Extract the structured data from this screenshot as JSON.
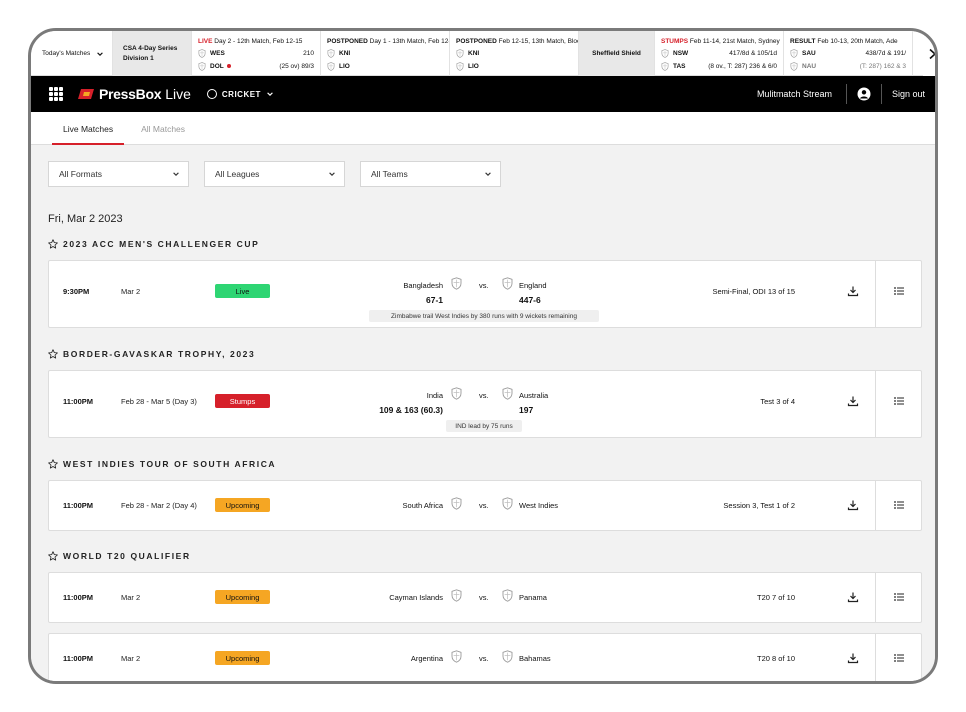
{
  "ticker": {
    "today_label": "Today's Matches",
    "series": {
      "line1": "CSA 4-Day Series",
      "line2": "Division 1"
    },
    "matches": [
      {
        "status": "LIVE",
        "status_color": "#d6202a",
        "detail": "Day 2 - 12th Match, Feb 12-15",
        "rows": [
          {
            "team": "WES",
            "score": "210",
            "dim": false,
            "live": false
          },
          {
            "team": "DOL",
            "score": "(25 ov) 89/3",
            "dim": false,
            "live": true
          }
        ]
      },
      {
        "status": "POSTPONED",
        "status_color": "#111111",
        "detail": "Day 1 - 13th Match, Feb 12-15",
        "rows": [
          {
            "team": "KNI",
            "score": "",
            "dim": false,
            "live": false
          },
          {
            "team": "LIO",
            "score": "",
            "dim": false,
            "live": false
          }
        ]
      },
      {
        "status": "POSTPONED",
        "status_color": "#111111",
        "detail": "Feb 12-15, 13th Match, Bloe.",
        "rows": [
          {
            "team": "KNI",
            "score": "",
            "dim": false,
            "live": false
          },
          {
            "team": "LIO",
            "score": "",
            "dim": false,
            "live": false
          }
        ]
      }
    ],
    "shield_label": "Sheffield Shield",
    "matches2": [
      {
        "status": "STUMPS",
        "status_color": "#d6202a",
        "detail": "Feb 11-14, 21st Match, Sydney",
        "rows": [
          {
            "team": "NSW",
            "score": "417/8d & 105/1d",
            "dim": false,
            "live": false
          },
          {
            "team": "TAS",
            "score": "(8 ov., T: 287) 236 & 6/0",
            "dim": false,
            "live": false
          }
        ]
      },
      {
        "status": "RESULT",
        "status_color": "#111111",
        "detail": "Feb 10-13, 20th Match, Ade",
        "rows": [
          {
            "team": "SAU",
            "score": "438/7d & 191/",
            "dim": false,
            "live": false
          },
          {
            "team": "NAU",
            "score": "(T: 287) 162 & 3",
            "dim": true,
            "live": false
          }
        ]
      }
    ]
  },
  "nav": {
    "brand_bold": "PressBox",
    "brand_light": "Live",
    "sport": "CRICKET",
    "multistream": "Mulitmatch Stream",
    "signout": "Sign out"
  },
  "tabs": [
    {
      "label": "Live Matches",
      "active": true
    },
    {
      "label": "All Matches",
      "active": false
    }
  ],
  "filters": [
    "All Formats",
    "All Leagues",
    "All Teams"
  ],
  "date_heading": "Fri, Mar 2 2023",
  "sections": [
    {
      "title": "2023 ACC MEN'S CHALLENGER CUP",
      "matches": [
        {
          "time": "9:30PM",
          "date": "Mar 2",
          "status": "Live",
          "kind": "live",
          "team_a": "Bangladesh",
          "score_a": "67-1",
          "team_b": "England",
          "score_b": "447-6",
          "stage": "Semi-Final, ODI 13 of 15",
          "note": "Zimbabwe trail West Indies by 380 runs with 9 wickets remaining"
        }
      ]
    },
    {
      "title": "BORDER-GAVASKAR TROPHY, 2023",
      "matches": [
        {
          "time": "11:00PM",
          "date": "Feb 28 - Mar 5 (Day 3)",
          "status": "Stumps",
          "kind": "stumps",
          "team_a": "India",
          "score_a": "109 & 163 (60.3)",
          "team_b": "Australia",
          "score_b": "197",
          "stage": "Test 3 of 4",
          "note": "IND lead by 75 runs"
        }
      ]
    },
    {
      "title": "WEST INDIES TOUR OF SOUTH AFRICA",
      "matches": [
        {
          "time": "11:00PM",
          "date": "Feb 28 - Mar 2 (Day 4)",
          "status": "Upcoming",
          "kind": "upcoming",
          "team_a": "South Africa",
          "score_a": "",
          "team_b": "West Indies",
          "score_b": "",
          "stage": "Session 3, Test 1 of 2",
          "note": ""
        }
      ]
    },
    {
      "title": "WORLD T20 QUALIFIER",
      "matches": [
        {
          "time": "11:00PM",
          "date": "Mar 2",
          "status": "Upcoming",
          "kind": "upcoming",
          "team_a": "Cayman Islands",
          "score_a": "",
          "team_b": "Panama",
          "score_b": "",
          "stage": "T20 7 of 10",
          "note": ""
        },
        {
          "time": "11:00PM",
          "date": "Mar 2",
          "status": "Upcoming",
          "kind": "upcoming",
          "team_a": "Argentina",
          "score_a": "",
          "team_b": "Bahamas",
          "score_b": "",
          "stage": "T20 8 of 10",
          "note": ""
        }
      ]
    }
  ],
  "vs_label": "vs.",
  "colors": {
    "accent": "#d6202a",
    "live": "#2ed573",
    "upcoming": "#f5a623"
  }
}
